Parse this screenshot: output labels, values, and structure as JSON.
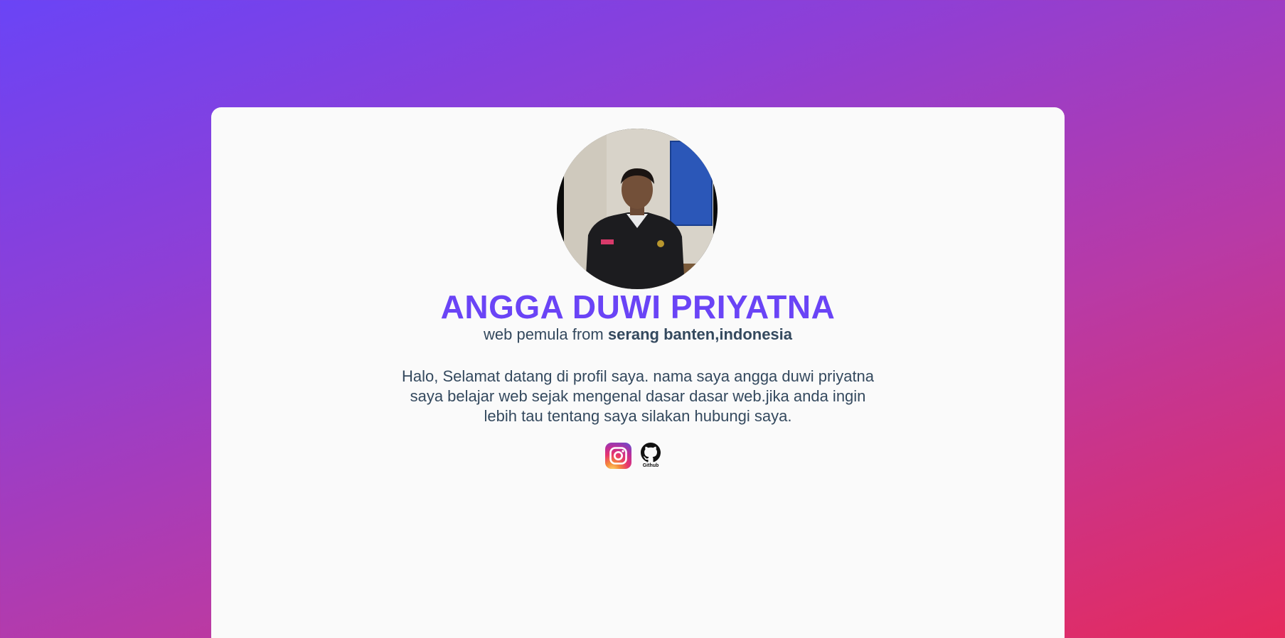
{
  "profile": {
    "name": "ANGGA DUWI PRIYATNA",
    "subtitle_prefix": "web pemula from ",
    "subtitle_location": "serang banten,indonesia",
    "about": "Halo, Selamat datang di profil saya. nama saya angga duwi priyatna saya belajar web sejak mengenal dasar dasar web.jika anda ingin lebih tau tentang saya silakan hubungi saya."
  },
  "socials": {
    "github_label": "Github"
  },
  "colors": {
    "accent": "#6a44f6",
    "text": "#34495e",
    "card": "#fafafa",
    "gradient_start": "#6a44f6",
    "gradient_end": "#e62a5c"
  },
  "icons": {
    "instagram": "instagram-icon",
    "github": "github-icon"
  }
}
